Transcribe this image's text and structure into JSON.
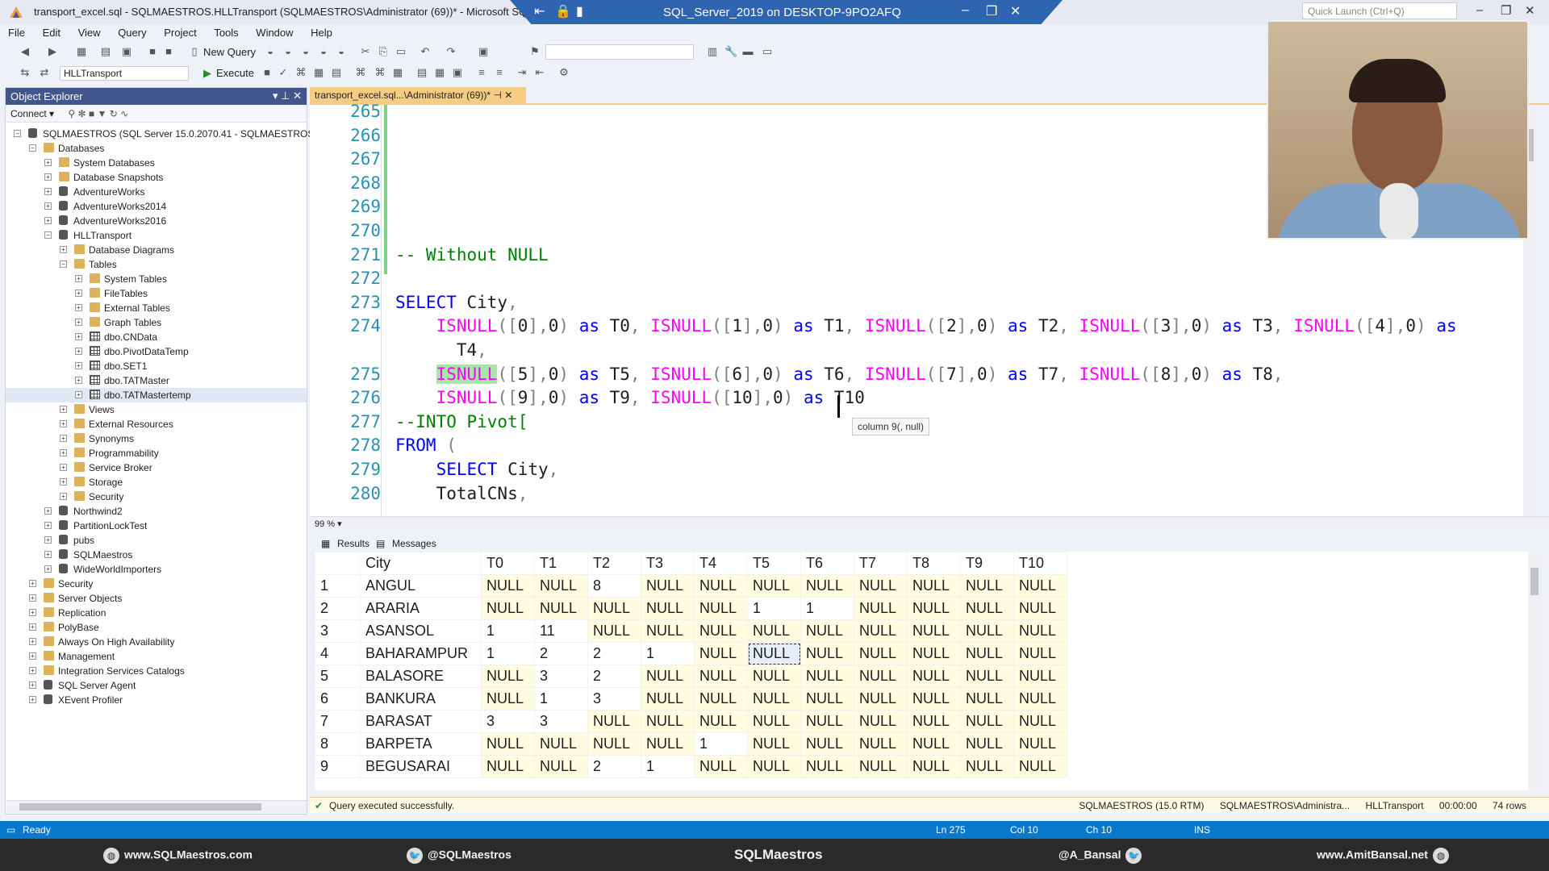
{
  "window": {
    "title": "transport_excel.sql - SQLMAESTROS.HLLTransport (SQLMAESTROS\\Administrator (69))* - Microsoft SQL Server Management Studio",
    "rdp_title": "SQL_Server_2019 on DESKTOP-9PO2AFQ",
    "quick_launch_placeholder": "Quick Launch (Ctrl+Q)"
  },
  "menu": [
    "File",
    "Edit",
    "View",
    "Query",
    "Project",
    "Tools",
    "Window",
    "Help"
  ],
  "toolbar": {
    "new_query": "New Query",
    "database": "HLLTransport",
    "execute": "Execute"
  },
  "object_explorer": {
    "title": "Object Explorer",
    "connect": "Connect",
    "nodes": [
      {
        "label": "SQLMAESTROS (SQL Server 15.0.2070.41 - SQLMAESTROS\\Adr",
        "level": 0,
        "expand": "-",
        "icon": "server"
      },
      {
        "label": "Databases",
        "level": 1,
        "expand": "-",
        "icon": "folder"
      },
      {
        "label": "System Databases",
        "level": 2,
        "expand": "+",
        "icon": "folder"
      },
      {
        "label": "Database Snapshots",
        "level": 2,
        "expand": "+",
        "icon": "folder"
      },
      {
        "label": "AdventureWorks",
        "level": 2,
        "expand": "+",
        "icon": "db"
      },
      {
        "label": "AdventureWorks2014",
        "level": 2,
        "expand": "+",
        "icon": "db"
      },
      {
        "label": "AdventureWorks2016",
        "level": 2,
        "expand": "+",
        "icon": "db"
      },
      {
        "label": "HLLTransport",
        "level": 2,
        "expand": "-",
        "icon": "db"
      },
      {
        "label": "Database Diagrams",
        "level": 3,
        "expand": "+",
        "icon": "folder"
      },
      {
        "label": "Tables",
        "level": 3,
        "expand": "-",
        "icon": "folder"
      },
      {
        "label": "System Tables",
        "level": 4,
        "expand": "+",
        "icon": "folder"
      },
      {
        "label": "FileTables",
        "level": 4,
        "expand": "+",
        "icon": "folder"
      },
      {
        "label": "External Tables",
        "level": 4,
        "expand": "+",
        "icon": "folder"
      },
      {
        "label": "Graph Tables",
        "level": 4,
        "expand": "+",
        "icon": "folder"
      },
      {
        "label": "dbo.CNData",
        "level": 4,
        "expand": "+",
        "icon": "table"
      },
      {
        "label": "dbo.PivotDataTemp",
        "level": 4,
        "expand": "+",
        "icon": "table"
      },
      {
        "label": "dbo.SET1",
        "level": 4,
        "expand": "+",
        "icon": "table"
      },
      {
        "label": "dbo.TATMaster",
        "level": 4,
        "expand": "+",
        "icon": "table"
      },
      {
        "label": "dbo.TATMastertemp",
        "level": 4,
        "expand": "+",
        "icon": "table",
        "selected": true
      },
      {
        "label": "Views",
        "level": 3,
        "expand": "+",
        "icon": "folder"
      },
      {
        "label": "External Resources",
        "level": 3,
        "expand": "+",
        "icon": "folder"
      },
      {
        "label": "Synonyms",
        "level": 3,
        "expand": "+",
        "icon": "folder"
      },
      {
        "label": "Programmability",
        "level": 3,
        "expand": "+",
        "icon": "folder"
      },
      {
        "label": "Service Broker",
        "level": 3,
        "expand": "+",
        "icon": "folder"
      },
      {
        "label": "Storage",
        "level": 3,
        "expand": "+",
        "icon": "folder"
      },
      {
        "label": "Security",
        "level": 3,
        "expand": "+",
        "icon": "folder"
      },
      {
        "label": "Northwind2",
        "level": 2,
        "expand": "+",
        "icon": "db"
      },
      {
        "label": "PartitionLockTest",
        "level": 2,
        "expand": "+",
        "icon": "db"
      },
      {
        "label": "pubs",
        "level": 2,
        "expand": "+",
        "icon": "db"
      },
      {
        "label": "SQLMaestros",
        "level": 2,
        "expand": "+",
        "icon": "db"
      },
      {
        "label": "WideWorldImporters",
        "level": 2,
        "expand": "+",
        "icon": "db"
      },
      {
        "label": "Security",
        "level": 1,
        "expand": "+",
        "icon": "folder"
      },
      {
        "label": "Server Objects",
        "level": 1,
        "expand": "+",
        "icon": "folder"
      },
      {
        "label": "Replication",
        "level": 1,
        "expand": "+",
        "icon": "folder"
      },
      {
        "label": "PolyBase",
        "level": 1,
        "expand": "+",
        "icon": "folder"
      },
      {
        "label": "Always On High Availability",
        "level": 1,
        "expand": "+",
        "icon": "folder"
      },
      {
        "label": "Management",
        "level": 1,
        "expand": "+",
        "icon": "folder"
      },
      {
        "label": "Integration Services Catalogs",
        "level": 1,
        "expand": "+",
        "icon": "folder"
      },
      {
        "label": "SQL Server Agent",
        "level": 1,
        "expand": "+",
        "icon": "agent"
      },
      {
        "label": "XEvent Profiler",
        "level": 1,
        "expand": "+",
        "icon": "xevent"
      }
    ]
  },
  "doc_tab": "transport_excel.sql...\\Administrator (69))*",
  "editor": {
    "lines": [
      {
        "n": "265",
        "code": ""
      },
      {
        "n": "266",
        "code": ""
      },
      {
        "n": "267",
        "code": ""
      },
      {
        "n": "268",
        "code": ""
      },
      {
        "n": "269",
        "code": ""
      },
      {
        "n": "270",
        "code": ""
      },
      {
        "n": "271",
        "code": "-- Without NULL"
      },
      {
        "n": "272",
        "code": ""
      },
      {
        "n": "273",
        "code": "SELECT City,"
      },
      {
        "n": "274",
        "code": "    ISNULL([0],0) as T0, ISNULL([1],0) as T1, ISNULL([2],0) as T2, ISNULL([3],0) as T3, ISNULL([4],0) as"
      },
      {
        "n": "",
        "code": "      T4,"
      },
      {
        "n": "275",
        "code": "    ISNULL([5],0) as T5, ISNULL([6],0) as T6, ISNULL([7],0) as T7, ISNULL([8],0) as T8,"
      },
      {
        "n": "276",
        "code": "    ISNULL([9],0) as T9, ISNULL([10],0) as T10"
      },
      {
        "n": "277",
        "code": "--INTO Pivot["
      },
      {
        "n": "278",
        "code": "FROM ("
      },
      {
        "n": "279",
        "code": "    SELECT City,"
      },
      {
        "n": "280",
        "code": "    TotalCNs,"
      }
    ],
    "tooltip": "column 9(, null)"
  },
  "zoom": "99 %",
  "result_tabs": {
    "results": "Results",
    "messages": "Messages"
  },
  "grid": {
    "columns": [
      "City",
      "T0",
      "T1",
      "T2",
      "T3",
      "T4",
      "T5",
      "T6",
      "T7",
      "T8",
      "T9",
      "T10"
    ],
    "rows": [
      [
        "1",
        "ANGUL",
        "NULL",
        "NULL",
        "8",
        "NULL",
        "NULL",
        "NULL",
        "NULL",
        "NULL",
        "NULL",
        "NULL",
        "NULL"
      ],
      [
        "2",
        "ARARIA",
        "NULL",
        "NULL",
        "NULL",
        "NULL",
        "NULL",
        "1",
        "1",
        "NULL",
        "NULL",
        "NULL",
        "NULL"
      ],
      [
        "3",
        "ASANSOL",
        "1",
        "11",
        "NULL",
        "NULL",
        "NULL",
        "NULL",
        "NULL",
        "NULL",
        "NULL",
        "NULL",
        "NULL"
      ],
      [
        "4",
        "BAHARAMPUR",
        "1",
        "2",
        "2",
        "1",
        "NULL",
        "NULL",
        "NULL",
        "NULL",
        "NULL",
        "NULL",
        "NULL"
      ],
      [
        "5",
        "BALASORE",
        "NULL",
        "3",
        "2",
        "NULL",
        "NULL",
        "NULL",
        "NULL",
        "NULL",
        "NULL",
        "NULL",
        "NULL"
      ],
      [
        "6",
        "BANKURA",
        "NULL",
        "1",
        "3",
        "NULL",
        "NULL",
        "NULL",
        "NULL",
        "NULL",
        "NULL",
        "NULL",
        "NULL"
      ],
      [
        "7",
        "BARASAT",
        "3",
        "3",
        "NULL",
        "NULL",
        "NULL",
        "NULL",
        "NULL",
        "NULL",
        "NULL",
        "NULL",
        "NULL"
      ],
      [
        "8",
        "BARPETA",
        "NULL",
        "NULL",
        "NULL",
        "NULL",
        "1",
        "NULL",
        "NULL",
        "NULL",
        "NULL",
        "NULL",
        "NULL"
      ],
      [
        "9",
        "BEGUSARAI",
        "NULL",
        "NULL",
        "2",
        "1",
        "NULL",
        "NULL",
        "NULL",
        "NULL",
        "NULL",
        "NULL",
        "NULL"
      ]
    ]
  },
  "query_status": {
    "message": "Query executed successfully.",
    "server": "SQLMAESTROS (15.0 RTM)",
    "user": "SQLMAESTROS\\Administra...",
    "database": "HLLTransport",
    "time": "00:00:00",
    "rows": "74 rows"
  },
  "statusbar": {
    "ready": "Ready",
    "ln": "Ln 275",
    "col": "Col 10",
    "ch": "Ch 10",
    "ins": "INS"
  },
  "footer": {
    "site": "www.SQLMaestros.com",
    "twitter1": "@SQLMaestros",
    "logo": "SQLMaestros",
    "twitter2": "@A_Bansal",
    "site2": "www.AmitBansal.net"
  },
  "colors": {
    "accent": "#0a79cc",
    "keyword": "#0000ff",
    "function": "#ff00ff",
    "comment": "#008000",
    "null_cell": "#fffce0"
  }
}
